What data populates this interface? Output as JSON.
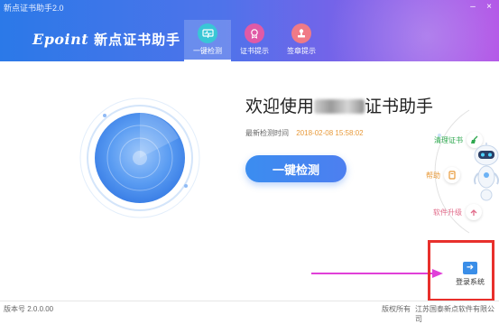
{
  "window": {
    "title": "新点证书助手2.0",
    "minimize_glyph": "–",
    "close_glyph": "×"
  },
  "logo": {
    "mark": "Epoint",
    "text": "新点证书助手"
  },
  "nav": {
    "tabs": [
      {
        "label": "一键检测",
        "icon": "monitor-icon",
        "active": true
      },
      {
        "label": "证书提示",
        "icon": "certificate-icon",
        "active": false
      },
      {
        "label": "签章提示",
        "icon": "seal-icon",
        "active": false
      }
    ]
  },
  "main": {
    "welcome_prefix": "欢迎使用",
    "welcome_suffix": "证书助手",
    "last_check_label": "最新检测时间",
    "last_check_time": "2018-02-08 15:58:02",
    "one_key_button": "一键检测"
  },
  "side": {
    "clean_label": "清理证书",
    "help_label": "帮助",
    "upgrade_label": "软件升级"
  },
  "login": {
    "label": "登录系统"
  },
  "footer": {
    "version": "版本号 2.0.0.00",
    "copyright": "版权所有",
    "company": "江苏国泰新点软件有限公司"
  },
  "colors": {
    "header_start": "#2b79e8",
    "header_end": "#b04fe6",
    "button_blue": "#3b8df0",
    "highlight_red": "#e8302c",
    "arrow_magenta": "#e040d8",
    "time_orange": "#e89a3a"
  }
}
